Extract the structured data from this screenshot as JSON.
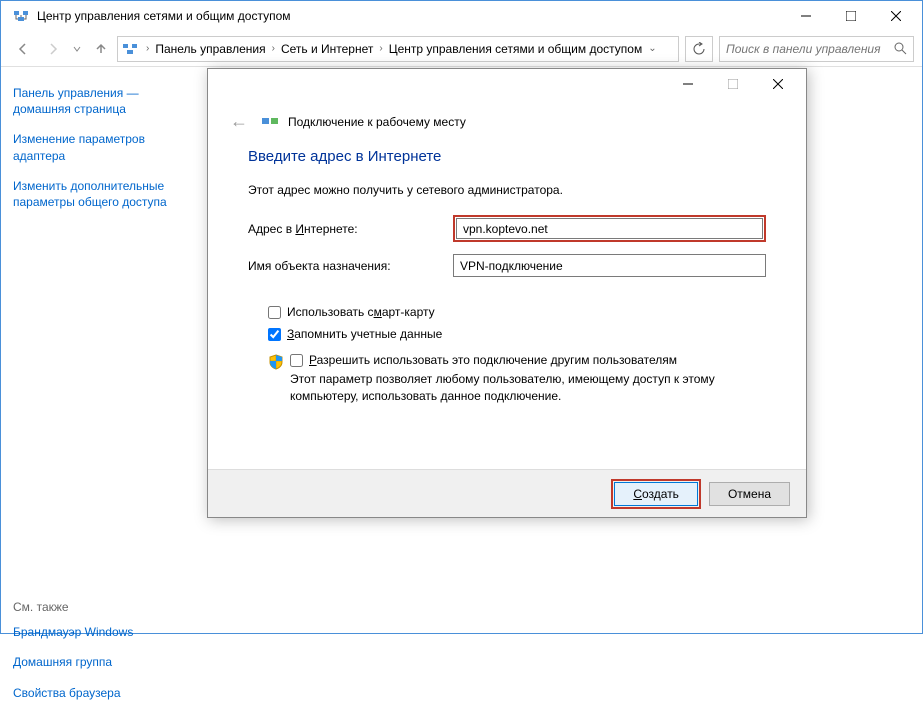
{
  "window": {
    "title": "Центр управления сетями и общим доступом"
  },
  "breadcrumb": {
    "items": [
      "Панель управления",
      "Сеть и Интернет",
      "Центр управления сетями и общим доступом"
    ]
  },
  "search": {
    "placeholder": "Поиск в панели управления"
  },
  "sidebar": {
    "home": "Панель управления — домашняя страница",
    "adapter": "Изменение параметров адаптера",
    "sharing": "Изменить дополнительные параметры общего доступа",
    "see_also": "См. также",
    "firewall": "Брандмауэр Windows",
    "homegroup": "Домашняя группа",
    "browser": "Свойства браузера"
  },
  "dialog": {
    "title": "Подключение к рабочему месту",
    "heading": "Введите адрес в Интернете",
    "subtitle": "Этот адрес можно получить у сетевого администратора.",
    "internet_addr_label_pre": "Адрес в ",
    "internet_addr_label_u": "И",
    "internet_addr_label_post": "нтернете:",
    "internet_addr_value": "vpn.koptevo.net",
    "dest_name_label": "Имя объекта назначения:",
    "dest_name_value": "VPN-подключение",
    "smartcard_pre": "Использовать с",
    "smartcard_u": "м",
    "smartcard_post": "арт-карту",
    "remember_u": "З",
    "remember_post": "апомнить учетные данные",
    "allow_others_u": "Р",
    "allow_others_post": "азрешить использовать это подключение другим пользователям",
    "allow_others_desc": "Этот параметр позволяет любому пользователю, имеющему доступ к этому компьютеру, использовать данное подключение.",
    "create_u": "С",
    "create_post": "оздать",
    "cancel": "Отмена"
  }
}
